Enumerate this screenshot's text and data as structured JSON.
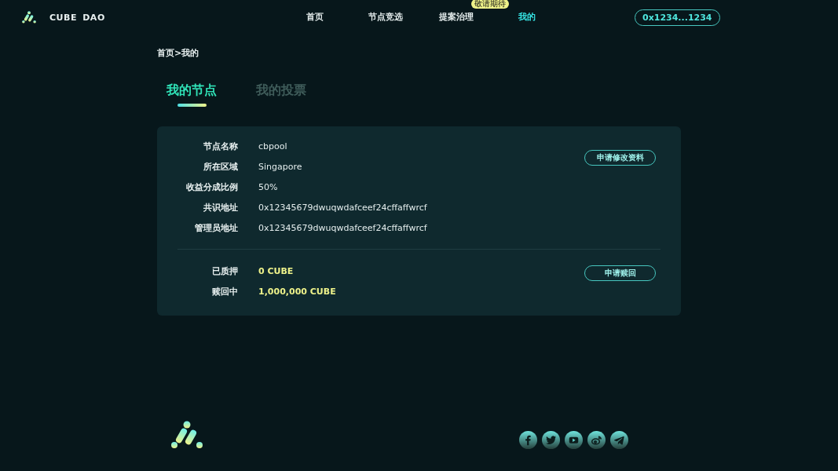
{
  "header": {
    "brand": "CUBE DAO",
    "nav": [
      {
        "label": "首页",
        "selected": false
      },
      {
        "label": "节点竞选",
        "selected": false
      },
      {
        "label": "提案治理",
        "selected": false,
        "badge": "敬请期待"
      },
      {
        "label": "我的",
        "selected": true
      }
    ],
    "wallet": "0x1234...1234"
  },
  "breadcrumb": "首页>我的",
  "tabs": [
    {
      "label": "我的节点",
      "selected": true
    },
    {
      "label": "我的投票",
      "selected": false
    }
  ],
  "node_info": {
    "rows": [
      {
        "label": "节点名称",
        "value": "cbpool"
      },
      {
        "label": "所在区域",
        "value": "Singapore"
      },
      {
        "label": "收益分成比例",
        "value": "50%"
      },
      {
        "label": "共识地址",
        "value": "0x12345679dwuqwdafceef24cffaffwrcf"
      },
      {
        "label": "管理员地址",
        "value": "0x12345679dwuqwdafceef24cffaffwrcf"
      }
    ],
    "button": "申请修改资料"
  },
  "stake_info": {
    "rows": [
      {
        "label": "已质押",
        "value": "0 CUBE"
      },
      {
        "label": "赎回中",
        "value": "1,000,000 CUBE"
      }
    ],
    "button": "申请赎回"
  },
  "footer": {
    "social": [
      {
        "kind": "facebook"
      },
      {
        "kind": "twitter"
      },
      {
        "kind": "youtube"
      },
      {
        "kind": "weibo"
      },
      {
        "kind": "telegram"
      }
    ]
  }
}
